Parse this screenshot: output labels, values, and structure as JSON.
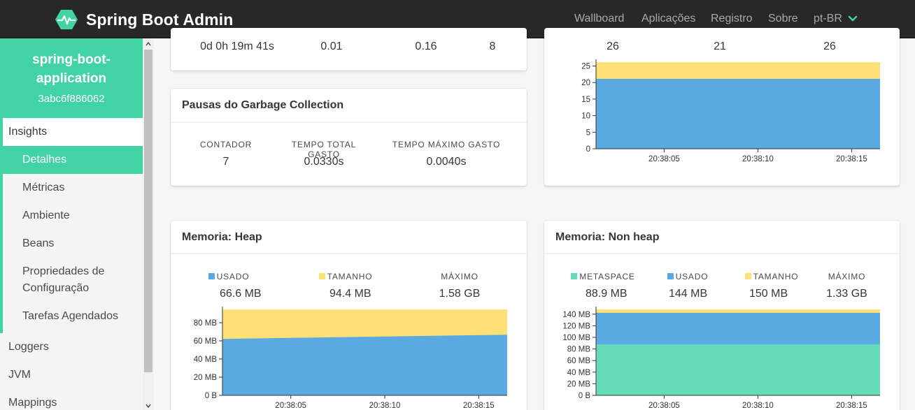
{
  "navbar": {
    "brand": "Spring Boot Admin",
    "links": [
      "Wallboard",
      "Aplicações",
      "Registro",
      "Sobre"
    ],
    "language": "pt-BR",
    "icons": {
      "logo": "heartbeat-icon",
      "dropdown": "chevron-down-icon"
    }
  },
  "colors": {
    "primary": "#42d3a5",
    "used": "#5aaae1",
    "size": "#ffe077",
    "metaspace": "#65dcb7",
    "navbar": "#282828"
  },
  "sidebar": {
    "app_name_line1": "spring-boot-",
    "app_name_line2": "application",
    "app_id": "3abc6f886062",
    "insights": "Insights",
    "sub_items": [
      "Detalhes",
      "Métricas",
      "Ambiente",
      "Beans",
      "Propriedades de",
      "Configuração",
      "Tarefas Agendados"
    ],
    "items": [
      "Loggers",
      "JVM",
      "Mappings"
    ]
  },
  "process_card": {
    "values": [
      "0d 0h 19m 41s",
      "0.01",
      "0.16",
      "8"
    ]
  },
  "gc_card": {
    "title": "Pausas do Garbage Collection",
    "labels": [
      "CONTADOR",
      "TEMPO TOTAL GASTO",
      "TEMPO MÁXIMO GASTO"
    ],
    "values": [
      "7",
      "0.0330s",
      "0.0040s"
    ]
  },
  "threads_card": {
    "values": [
      "26",
      "21",
      "26"
    ]
  },
  "heap_card": {
    "title": "Memoria: Heap",
    "labels": [
      "USADO",
      "TAMANHO",
      "MÁXIMO"
    ],
    "values": [
      "66.6 MB",
      "94.4 MB",
      "1.58 GB"
    ]
  },
  "nonheap_card": {
    "title": "Memoria: Non heap",
    "labels": [
      "METASPACE",
      "USADO",
      "TAMANHO",
      "MÁXIMO"
    ],
    "values": [
      "88.9 MB",
      "144 MB",
      "150 MB",
      "1.33 GB"
    ]
  },
  "chart_data": [
    {
      "type": "area",
      "ylim": [
        0,
        26
      ],
      "y_ticks": [
        "0",
        "5",
        "10",
        "15",
        "20",
        "25"
      ],
      "x_ticks": [
        "20:38:05",
        "20:38:10",
        "20:38:15"
      ],
      "series": [
        {
          "name": "",
          "color": "#ffe077",
          "values": [
            26,
            26
          ]
        },
        {
          "name": "",
          "color": "#5aaae1",
          "values": [
            21,
            21
          ]
        }
      ]
    },
    {
      "type": "area",
      "ylim": [
        0,
        94.4
      ],
      "y_ticks": [
        "0 B",
        "20 MB",
        "40 MB",
        "60 MB",
        "80 MB"
      ],
      "x_ticks": [
        "20:38:05",
        "20:38:10",
        "20:38:15"
      ],
      "series": [
        {
          "name": "TAMANHO",
          "color": "#ffe077",
          "values": [
            94.4,
            94.4
          ]
        },
        {
          "name": "USADO",
          "color": "#5aaae1",
          "values": [
            62,
            66.6
          ]
        }
      ]
    },
    {
      "type": "area",
      "ylim": [
        0,
        150
      ],
      "y_ticks": [
        "0 B",
        "20 MB",
        "40 MB",
        "60 MB",
        "80 MB",
        "100 MB",
        "120 MB",
        "140 MB"
      ],
      "x_ticks": [
        "20:38:05",
        "20:38:10",
        "20:38:15"
      ],
      "series": [
        {
          "name": "TAMANHO",
          "color": "#ffe077",
          "values": [
            150,
            150
          ]
        },
        {
          "name": "USADO",
          "color": "#5aaae1",
          "values": [
            144,
            144
          ]
        },
        {
          "name": "METASPACE",
          "color": "#65dcb7",
          "values": [
            88.9,
            88.9
          ]
        }
      ]
    }
  ]
}
